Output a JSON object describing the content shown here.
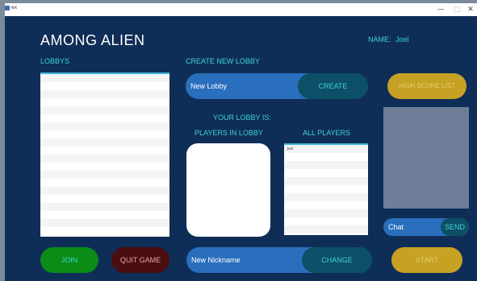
{
  "window": {
    "title": "ex",
    "minimize_glyph": "—",
    "maximize_glyph": "□",
    "close_glyph": "✕"
  },
  "header": {
    "app_title": "AMONG ALIEN",
    "name_label": "NAME:",
    "name_value": "Joel"
  },
  "lobbies": {
    "label": "LOBBYS"
  },
  "create_lobby": {
    "label": "CREATE NEW LOBBY",
    "input_value": "",
    "input_placeholder": "New Lobby",
    "button_label": "CREATE"
  },
  "high_score": {
    "button_label": "HIGH SCORE LIST"
  },
  "your_lobby": {
    "label": "YOUR LOBBY IS:"
  },
  "players_in_lobby": {
    "label": "PLAYERS IN LOBBY"
  },
  "all_players": {
    "label": "ALL PLAYERS",
    "items": [
      "Joel"
    ]
  },
  "chat": {
    "input_value": "",
    "input_placeholder": "Chat",
    "send_label": "SEND"
  },
  "actions": {
    "join_label": "JOIN",
    "quit_label": "QUIT GAME",
    "start_label": "START"
  },
  "nickname": {
    "input_value": "",
    "input_placeholder": "New Nickname",
    "change_label": "CHANGE"
  },
  "colors": {
    "background": "#0f2e57",
    "accent_cyan": "#3fd3d3",
    "pill_blue": "#2a6fbd",
    "pill_dark_teal": "#0d4f66",
    "gold": "#c7a124",
    "join_green": "#0a8c16",
    "quit_maroon": "#4a0d10",
    "chat_area": "#6e7e99"
  }
}
